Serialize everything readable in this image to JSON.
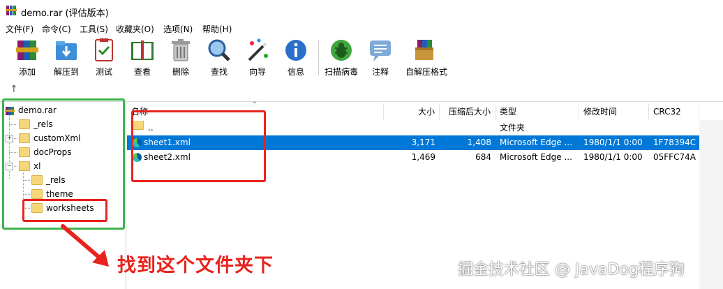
{
  "window": {
    "title": "demo.rar (评估版本)"
  },
  "menu": [
    "文件(F)",
    "命令(C)",
    "工具(S)",
    "收藏夹(O)",
    "选项(N)",
    "帮助(H)"
  ],
  "toolbar": [
    {
      "label": "添加",
      "icon": "add-archive-icon"
    },
    {
      "label": "解压到",
      "icon": "extract-to-icon"
    },
    {
      "label": "测试",
      "icon": "test-icon"
    },
    {
      "label": "查看",
      "icon": "view-book-icon"
    },
    {
      "label": "删除",
      "icon": "delete-trash-icon"
    },
    {
      "label": "查找",
      "icon": "find-magnifier-icon"
    },
    {
      "label": "向导",
      "icon": "wizard-wand-icon"
    },
    {
      "label": "信息",
      "icon": "info-icon"
    },
    {
      "label": "扫描病毒",
      "icon": "scan-virus-icon"
    },
    {
      "label": "注释",
      "icon": "comment-icon"
    },
    {
      "label": "自解压格式",
      "icon": "sfx-icon"
    }
  ],
  "tree": {
    "root": "demo.rar",
    "items": [
      {
        "label": "_rels"
      },
      {
        "label": "customXml"
      },
      {
        "label": "docProps"
      },
      {
        "label": "xl"
      },
      {
        "label": "_rels"
      },
      {
        "label": "theme"
      },
      {
        "label": "worksheets"
      }
    ]
  },
  "columns": [
    "名称",
    "大小",
    "压缩后大小",
    "类型",
    "修改时间",
    "CRC32"
  ],
  "rows": [
    {
      "name": "..",
      "size": "",
      "packed": "",
      "type": "文件夹",
      "modified": "",
      "crc": ""
    },
    {
      "name": "sheet1.xml",
      "size": "3,171",
      "packed": "1,408",
      "type": "Microsoft Edge ...",
      "modified": "1980/1/1 0:00",
      "crc": "1F78394C"
    },
    {
      "name": "sheet2.xml",
      "size": "1,469",
      "packed": "684",
      "type": "Microsoft Edge ...",
      "modified": "1980/1/1 0:00",
      "crc": "05FFC74A"
    }
  ],
  "annotation": "找到这个文件夹下",
  "watermark": "掘金技术社区 @ JavaDog程序狗",
  "colors": {
    "selection": "#0078d7",
    "annotation_red": "#e8231d",
    "annotation_green": "#3cb44b",
    "folder": "#f5d77a"
  }
}
